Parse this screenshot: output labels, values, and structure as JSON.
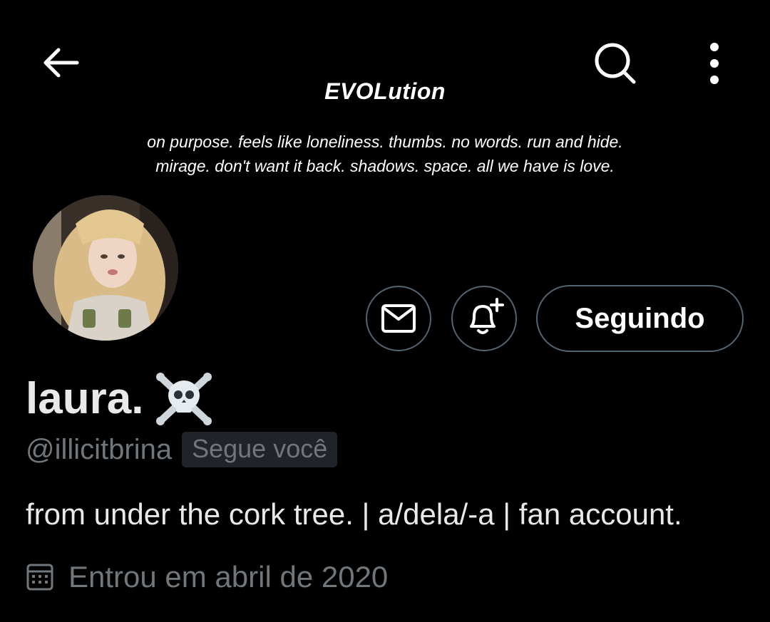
{
  "header": {
    "back_icon": "arrow-left-icon",
    "search_icon": "search-icon",
    "more_icon": "more-vertical-icon"
  },
  "banner": {
    "title": "EVOLution",
    "subtitle_line1": "on purpose. feels like loneliness. thumbs. no words. run and hide.",
    "subtitle_line2": "mirage. don't want it back. shadows. space. all we have is love."
  },
  "profile": {
    "display_name": "laura.",
    "name_emoji_icon": "skull-crossbones-icon",
    "handle": "@illicitbrina",
    "follows_you_label": "Segue você",
    "bio": "from under the cork tree. | a/dela/-a | fan account.",
    "joined_icon": "calendar-icon",
    "joined": "Entrou em abril de 2020"
  },
  "actions": {
    "message_icon": "envelope-icon",
    "notify_icon": "bell-plus-icon",
    "follow_label": "Seguindo"
  },
  "colors": {
    "background": "#000000",
    "text_primary": "#e7e9ea",
    "text_secondary": "#71767b",
    "border": "#536471",
    "badge_bg": "#202327"
  }
}
